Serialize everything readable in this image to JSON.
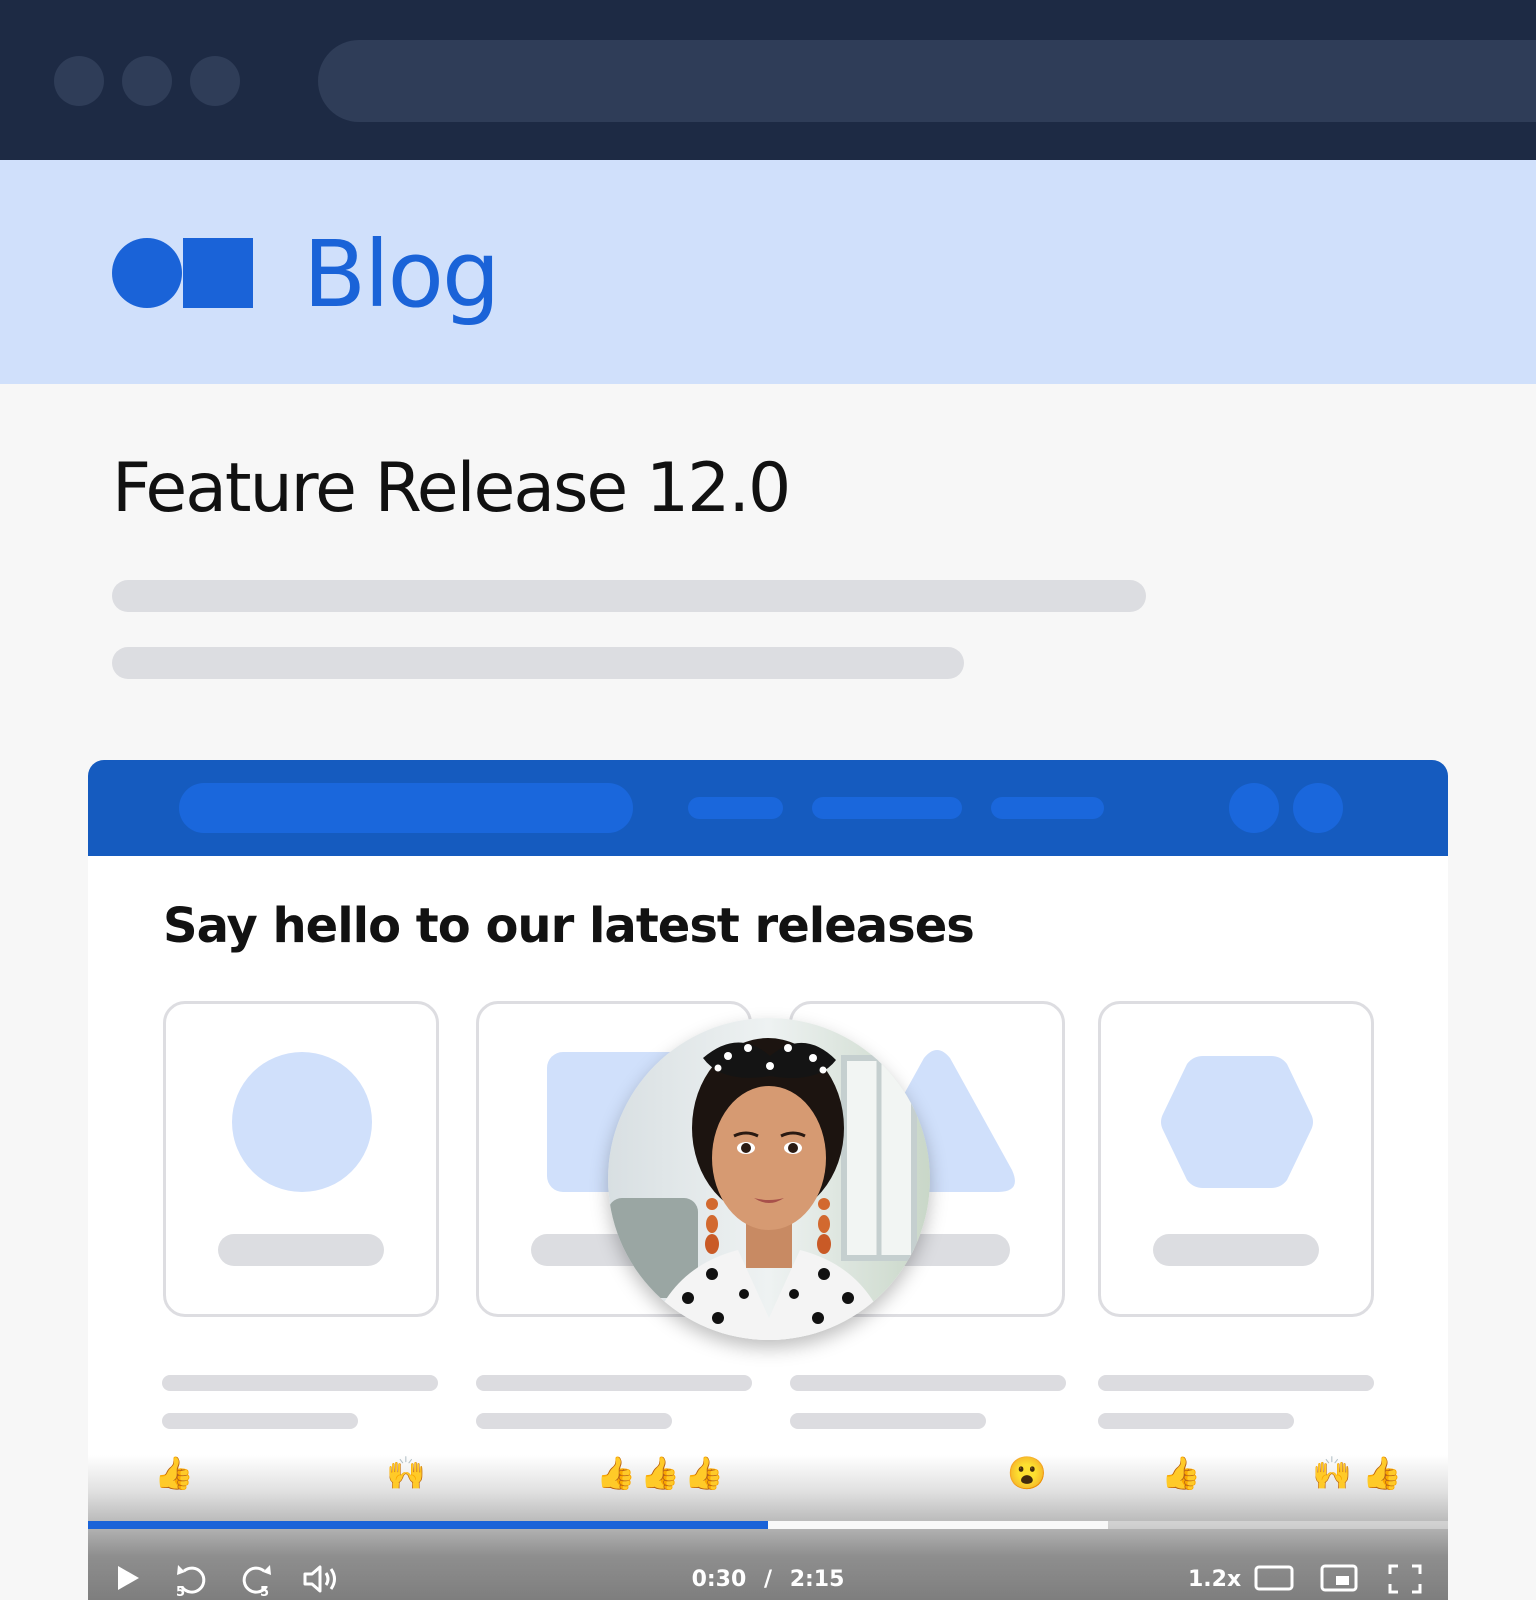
{
  "browser": {
    "window_controls": [
      "dot",
      "dot",
      "dot"
    ]
  },
  "blog": {
    "title": "Blog",
    "logo_icon": "circle-square-logo"
  },
  "post": {
    "title": "Feature Release 12.0"
  },
  "video": {
    "headline": "Say hello to our latest releases",
    "cards": [
      {
        "shape": "circle"
      },
      {
        "shape": "rounded-square"
      },
      {
        "shape": "triangle"
      },
      {
        "shape": "hexagon"
      }
    ],
    "reactions": [
      "👍",
      "🙌",
      "👍",
      "👍",
      "👍",
      "😮",
      "👍",
      "🙌",
      "👍"
    ],
    "progress": {
      "played_fraction": 0.5,
      "buffered_fraction": 0.75
    },
    "time": {
      "current": "0:30",
      "separator": "/",
      "total": "2:15"
    },
    "speed": "1.2x",
    "icons": {
      "play": "play-icon",
      "rewind": "rewind-5-icon",
      "rewind_label": "5",
      "forward": "forward-5-icon",
      "forward_label": "5",
      "volume": "volume-icon",
      "theater": "theater-mode-icon",
      "pip": "picture-in-picture-icon",
      "fullscreen": "fullscreen-icon"
    }
  },
  "colors": {
    "chrome": "#1d2a44",
    "brand": "#1a63d8",
    "header_bg": "#d0e0fb",
    "nav": "#155bbf"
  }
}
